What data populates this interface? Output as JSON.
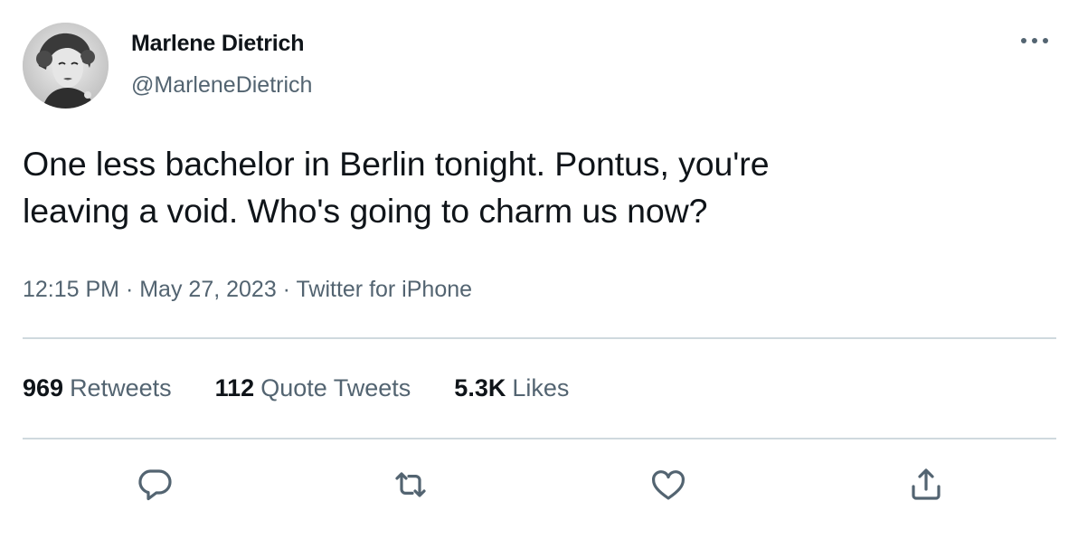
{
  "user": {
    "name": "Marlene Dietrich",
    "handle": "@MarleneDietrich"
  },
  "tweet": {
    "text": "One less bachelor in Berlin tonight. Pontus, you're\nleaving a void. Who's going to charm us now?",
    "time": "12:15 PM",
    "date": "May 27, 2023",
    "source": "Twitter for iPhone",
    "separator": " · "
  },
  "stats": {
    "retweets_count": "969",
    "retweets_label": "Retweets",
    "quotes_count": "112",
    "quotes_label": "Quote Tweets",
    "likes_count": "5.3K",
    "likes_label": "Likes"
  },
  "icons": {
    "more": "more-horizontal-icon",
    "reply": "reply-icon",
    "retweet": "retweet-icon",
    "like": "heart-icon",
    "share": "share-icon"
  },
  "colors": {
    "text_primary": "#0f1419",
    "text_secondary": "#536471",
    "divider": "#cfd9de"
  }
}
